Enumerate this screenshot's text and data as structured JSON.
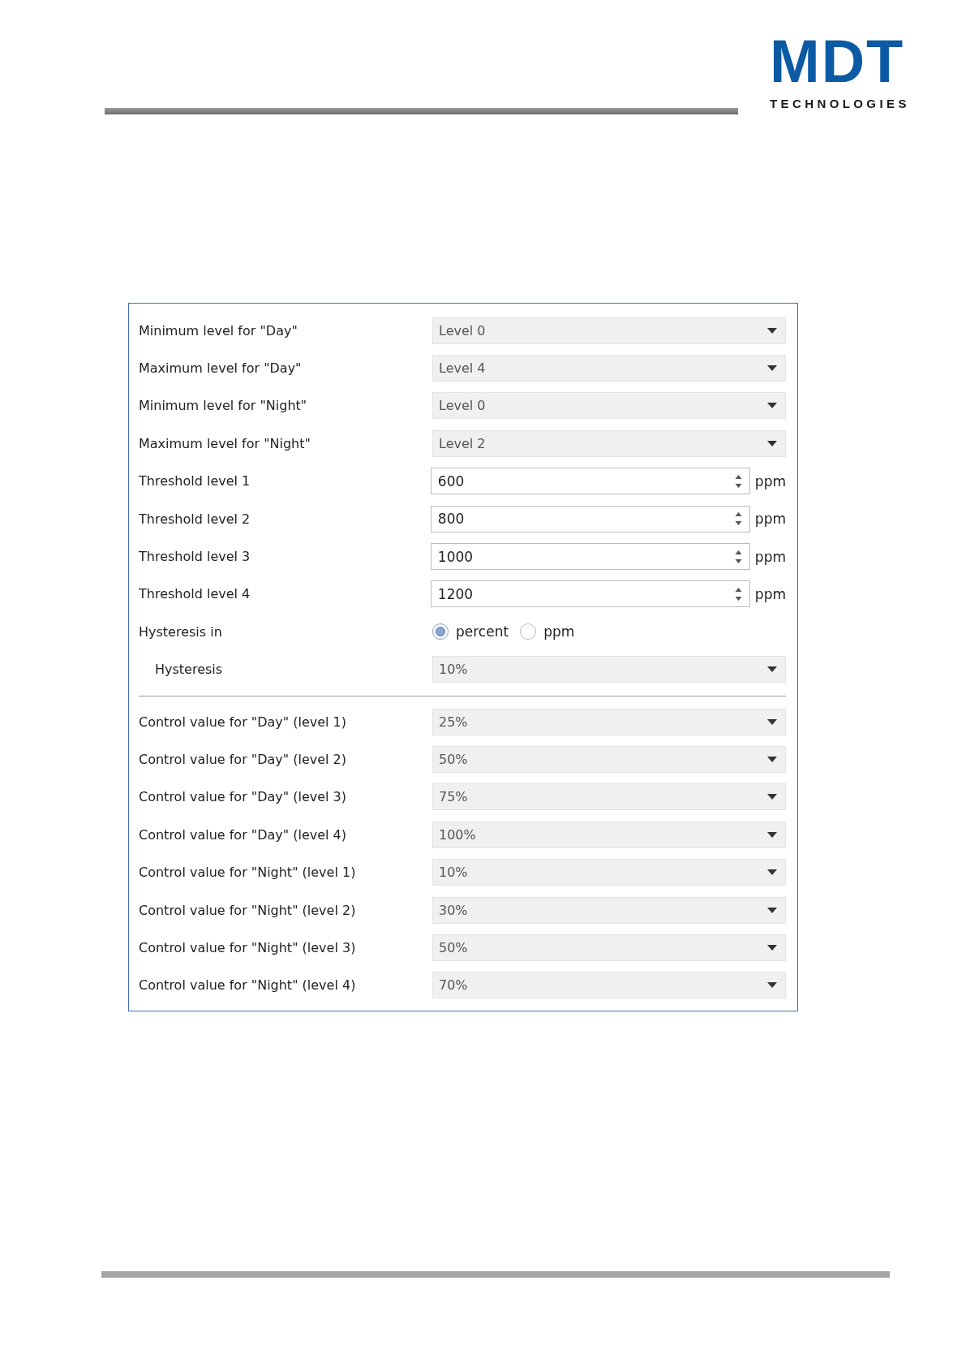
{
  "logo": {
    "wordmark": "MDT",
    "tagline": "TECHNOLOGIES"
  },
  "settings": {
    "rows": [
      {
        "kind": "dropdown",
        "label": "Minimum level for \"Day\"",
        "value": "Level 0"
      },
      {
        "kind": "dropdown",
        "label": "Maximum level for \"Day\"",
        "value": "Level 4"
      },
      {
        "kind": "dropdown",
        "label": "Minimum level for \"Night\"",
        "value": "Level 0"
      },
      {
        "kind": "dropdown",
        "label": "Maximum level for \"Night\"",
        "value": "Level 2"
      },
      {
        "kind": "spin",
        "label": "Threshold level 1",
        "value": "600",
        "unit": "ppm"
      },
      {
        "kind": "spin",
        "label": "Threshold level 2",
        "value": "800",
        "unit": "ppm"
      },
      {
        "kind": "spin",
        "label": "Threshold level 3",
        "value": "1000",
        "unit": "ppm"
      },
      {
        "kind": "spin",
        "label": "Threshold level 4",
        "value": "1200",
        "unit": "ppm"
      },
      {
        "kind": "radio",
        "label": "Hysteresis in",
        "options": [
          {
            "label": "percent",
            "selected": true
          },
          {
            "label": "ppm",
            "selected": false
          }
        ],
        "children": [
          {
            "kind": "dropdown",
            "label": "Hysteresis",
            "value": "10%"
          }
        ]
      }
    ],
    "control_values": [
      {
        "kind": "dropdown",
        "label": "Control value for \"Day\" (level 1)",
        "value": "25%"
      },
      {
        "kind": "dropdown",
        "label": "Control value for \"Day\" (level 2)",
        "value": "50%"
      },
      {
        "kind": "dropdown",
        "label": "Control value for \"Day\" (level 3)",
        "value": "75%"
      },
      {
        "kind": "dropdown",
        "label": "Control value for \"Day\" (level 4)",
        "value": "100%"
      },
      {
        "kind": "dropdown",
        "label": "Control value for \"Night\" (level 1)",
        "value": "10%"
      },
      {
        "kind": "dropdown",
        "label": "Control value for \"Night\" (level 2)",
        "value": "30%"
      },
      {
        "kind": "dropdown",
        "label": "Control value for \"Night\" (level 3)",
        "value": "50%"
      },
      {
        "kind": "dropdown",
        "label": "Control value for \"Night\" (level 4)",
        "value": "70%"
      }
    ]
  }
}
